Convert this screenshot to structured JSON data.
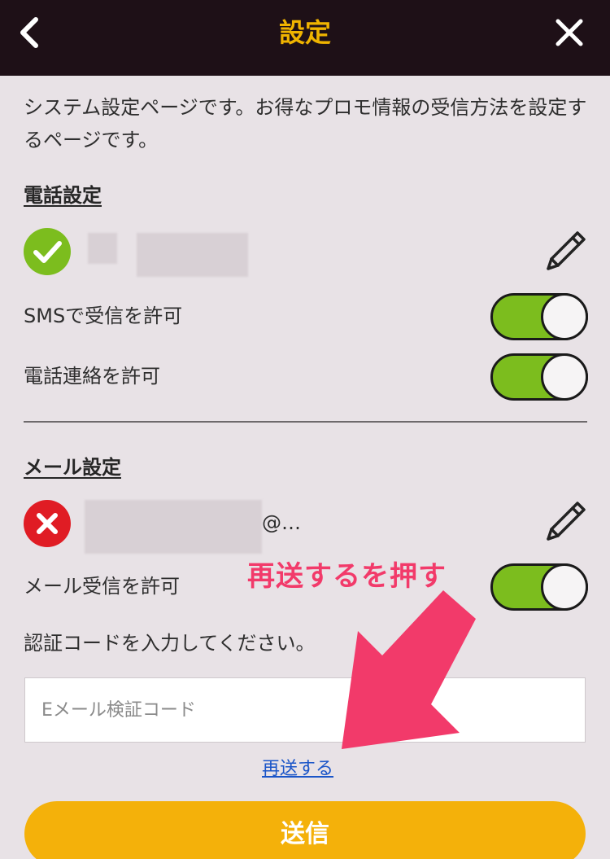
{
  "header": {
    "title": "設定",
    "back_icon": "chevron-left-icon",
    "close_icon": "close-icon",
    "title_color": "#f0b400",
    "background": "#1e1017"
  },
  "intro_text": "システム設定ページです。お得なプロモ情報の受信方法を設定するページです。",
  "phone_section": {
    "title": "電話設定",
    "status_icon": "check-circle-icon",
    "status_color": "#7cbd1e",
    "edit_icon": "pencil-icon",
    "rows": [
      {
        "label": "SMSで受信を許可",
        "enabled": true
      },
      {
        "label": "電話連絡を許可",
        "enabled": true
      }
    ]
  },
  "mail_section": {
    "title": "メール設定",
    "status_icon": "error-circle-icon",
    "status_color": "#e01c24",
    "email_suffix": "@…",
    "edit_icon": "pencil-icon",
    "rows": [
      {
        "label": "メール受信を許可",
        "enabled": true
      }
    ],
    "code_prompt": "認証コードを入力してください。",
    "code_input": {
      "value": "",
      "placeholder": "Eメール検証コード"
    },
    "resend_label": "再送する"
  },
  "submit_label": "送信",
  "annotation": {
    "text": "再送するを押す",
    "color": "#f23a6a",
    "arrow_icon": "arrow-down-left-icon"
  },
  "toggle_on_color": "#7cbd1e",
  "accent_color": "#f4b10a"
}
